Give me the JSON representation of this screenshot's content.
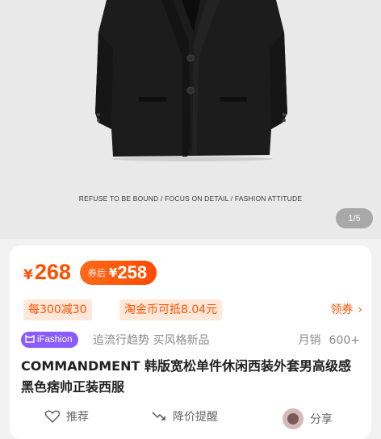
{
  "product_image": {
    "tagline": "REFUSE TO BE BOUND / FOCUS ON DETAIL / FASHION ATTITUDE",
    "pager": "1/5"
  },
  "price": {
    "symbol": "¥",
    "value": "268",
    "coupon_label": "券后",
    "coupon_symbol": "¥",
    "coupon_value": "258"
  },
  "promotions": {
    "discount": "每300减30",
    "coins": "淘金币可抵8.04元",
    "coupon_link": "领券"
  },
  "fashion": {
    "badge": "iFashion",
    "slogan": "追流行趋势 买风格新品",
    "sales_label": "月销",
    "sales_count": "600+"
  },
  "product": {
    "title": "COMMANDMENT 韩版宽松单件休闲西装外套男高级感黑色痞帅正装西服"
  },
  "actions": {
    "recommend": "推荐",
    "price_alert": "降价提醒",
    "share": "分享"
  },
  "colors": {
    "accent": "#ff5000",
    "badge": "#8a5cff"
  }
}
